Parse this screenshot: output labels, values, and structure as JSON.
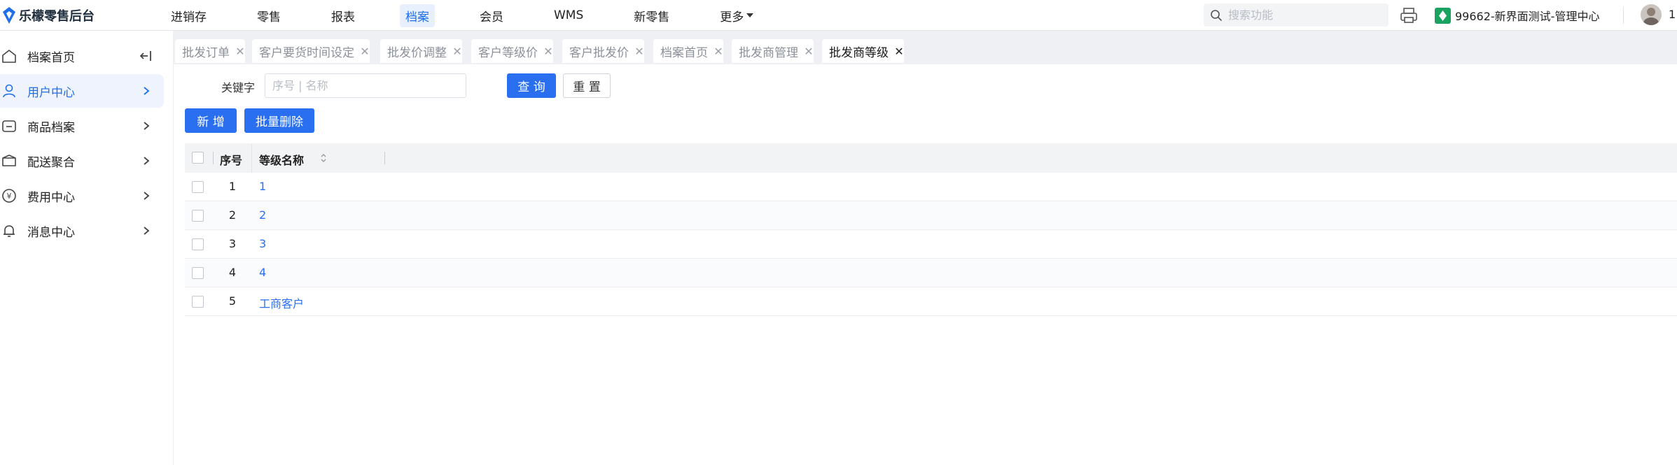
{
  "app": {
    "title": "乐檬零售后台",
    "brand_color": "#1f6feb"
  },
  "nav": {
    "items": [
      {
        "label": "进销存",
        "active": false
      },
      {
        "label": "零售",
        "active": false
      },
      {
        "label": "报表",
        "active": false
      },
      {
        "label": "档案",
        "active": true
      },
      {
        "label": "会员",
        "active": false
      },
      {
        "label": "WMS",
        "active": false
      },
      {
        "label": "新零售",
        "active": false
      },
      {
        "label": "更多",
        "active": false,
        "dropdown": true
      }
    ]
  },
  "header": {
    "search_placeholder": "搜索功能",
    "print_icon": "printer-icon",
    "store_name": "99662-新界面测试-管理中心",
    "user_initial": "1"
  },
  "sidebar": {
    "items": [
      {
        "label": "档案首页",
        "icon": "home-icon",
        "active": false,
        "trailing": "collapse-icon"
      },
      {
        "label": "用户中心",
        "icon": "user-icon",
        "active": true,
        "trailing": "chevron-right-icon"
      },
      {
        "label": "商品档案",
        "icon": "product-icon",
        "active": false,
        "trailing": "chevron-right-icon"
      },
      {
        "label": "配送聚合",
        "icon": "delivery-icon",
        "active": false,
        "trailing": "chevron-right-icon"
      },
      {
        "label": "费用中心",
        "icon": "yen-icon",
        "active": false,
        "trailing": "chevron-right-icon"
      },
      {
        "label": "消息中心",
        "icon": "bell-icon",
        "active": false,
        "trailing": "chevron-right-icon"
      }
    ]
  },
  "tabs": [
    {
      "label": "批发订单",
      "active": false
    },
    {
      "label": "客户要货时间设定",
      "active": false
    },
    {
      "label": "批发价调整",
      "active": false
    },
    {
      "label": "客户等级价",
      "active": false
    },
    {
      "label": "客户批发价",
      "active": false
    },
    {
      "label": "档案首页",
      "active": false
    },
    {
      "label": "批发商管理",
      "active": false
    },
    {
      "label": "批发商等级",
      "active": true
    }
  ],
  "filter": {
    "keyword_label": "关键字",
    "keyword_placeholder": "序号 | 名称",
    "keyword_value": "",
    "query_label": "查 询",
    "reset_label": "重 置"
  },
  "actions": {
    "add_label": "新 增",
    "batch_delete_label": "批量删除"
  },
  "table": {
    "columns": [
      "序号",
      "等级名称"
    ],
    "rows": [
      {
        "index": "1",
        "name": "1"
      },
      {
        "index": "2",
        "name": "2"
      },
      {
        "index": "3",
        "name": "3"
      },
      {
        "index": "4",
        "name": "4"
      },
      {
        "index": "5",
        "name": "工商客户"
      }
    ]
  }
}
